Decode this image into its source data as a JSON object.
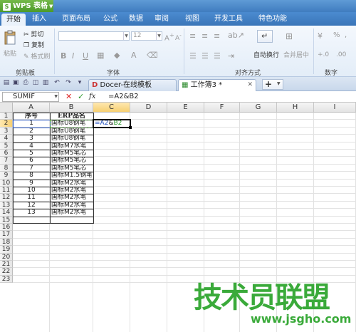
{
  "app": {
    "name": "WPS 表格"
  },
  "menu": {
    "tabs": [
      {
        "label": "开始"
      },
      {
        "label": "插入"
      },
      {
        "label": "页面布局"
      },
      {
        "label": "公式"
      },
      {
        "label": "数据"
      },
      {
        "label": "审阅"
      },
      {
        "label": "视图"
      },
      {
        "label": "开发工具"
      },
      {
        "label": "特色功能"
      }
    ],
    "active_tab": "开始"
  },
  "ribbon": {
    "clipboard": {
      "paste": "粘贴",
      "cut": "剪切",
      "copy": "复制",
      "format_painter": "格式刷",
      "group": "剪贴板"
    },
    "font": {
      "size": "12",
      "bold": "B",
      "italic": "I",
      "underline": "U",
      "grow": "A",
      "shrink": "A",
      "group": "字体"
    },
    "alignment": {
      "wrap": "自动换行",
      "merge": "合并居中",
      "group": "对齐方式"
    },
    "number": {
      "percent": "%",
      "comma": ",",
      "group": "数字"
    }
  },
  "doc_tabs": [
    {
      "label": "Docer-在线模板"
    },
    {
      "label": "工作簿3 *"
    }
  ],
  "formula_bar": {
    "name_box": "SUMIF",
    "cancel": "✕",
    "enter": "✓",
    "fx": "fx",
    "formula": "=A2&B2"
  },
  "sheet": {
    "columns": [
      "A",
      "B",
      "C",
      "D",
      "E",
      "F",
      "G",
      "H",
      "I"
    ],
    "rows": [
      "1",
      "2",
      "3",
      "4",
      "5",
      "6",
      "7",
      "8",
      "9",
      "10",
      "11",
      "12",
      "13",
      "14",
      "15",
      "16",
      "17",
      "18",
      "19",
      "20",
      "21",
      "22",
      "23"
    ],
    "headers": {
      "a1": "序号",
      "b1": "ERP品名"
    },
    "data": [
      {
        "a": "1",
        "b": "国标U8钢笔"
      },
      {
        "a": "2",
        "b": "国标U8钢笔"
      },
      {
        "a": "3",
        "b": "国标U8钢笔"
      },
      {
        "a": "4",
        "b": "国标M7水笔"
      },
      {
        "a": "5",
        "b": "国标M5笔芯"
      },
      {
        "a": "6",
        "b": "国标M5笔芯"
      },
      {
        "a": "7",
        "b": "国标M5笔芯"
      },
      {
        "a": "8",
        "b": "国标M1.5钢笔"
      },
      {
        "a": "9",
        "b": "国标M2水笔"
      },
      {
        "a": "10",
        "b": "国标M2水笔"
      },
      {
        "a": "11",
        "b": "国标M2水笔"
      },
      {
        "a": "12",
        "b": "国标M2水笔"
      },
      {
        "a": "13",
        "b": "国标M2水笔"
      }
    ],
    "editing_cell": {
      "ref_a": "=A2",
      "amp": "&",
      "ref_b": "B2"
    }
  },
  "watermark": {
    "title": "技术员联盟",
    "url": "www.jsgho.com"
  },
  "colors": {
    "ref_a": "#1f4fbf",
    "ref_b": "#2e9b2e",
    "brand_green": "#3aaa3a"
  }
}
